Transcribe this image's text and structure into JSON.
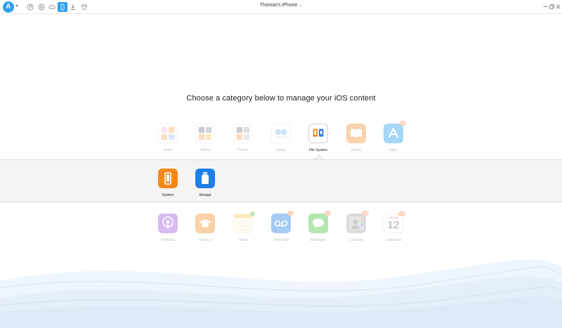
{
  "app": {
    "logo_text": "A",
    "device_title": "Thomas's iPhone"
  },
  "toolbar": {
    "items": [
      {
        "name": "music-icon"
      },
      {
        "name": "restore-icon"
      },
      {
        "name": "cloud-icon"
      },
      {
        "name": "device-icon",
        "active": true
      },
      {
        "name": "download-icon"
      },
      {
        "name": "tshirt-icon"
      }
    ]
  },
  "heading": "Choose a category below to manage your iOS content",
  "categories_top": [
    {
      "label": "Audio",
      "icon": "audio-icon"
    },
    {
      "label": "Videos",
      "icon": "videos-icon"
    },
    {
      "label": "Photos",
      "icon": "photos-icon"
    },
    {
      "label": "Selais",
      "icon": "selais-icon"
    },
    {
      "label": "File System",
      "icon": "file-system-icon",
      "active": true
    },
    {
      "label": "Books",
      "icon": "books-icon"
    },
    {
      "label": "Apps",
      "icon": "apps-icon",
      "badge": "10"
    }
  ],
  "subcategories": [
    {
      "label": "System",
      "icon": "system-icon"
    },
    {
      "label": "Storage",
      "icon": "storage-icon"
    }
  ],
  "categories_bottom": [
    {
      "label": "Podcasts",
      "icon": "podcasts-icon"
    },
    {
      "label": "iTunes U",
      "icon": "itunes-u-icon"
    },
    {
      "label": "Notes",
      "icon": "notes-icon",
      "badge": ""
    },
    {
      "label": "Voice Mail",
      "icon": "voice-mail-icon",
      "badge": "2"
    },
    {
      "label": "Messages",
      "icon": "messages-icon",
      "badge": "28"
    },
    {
      "label": "Contacts",
      "icon": "contacts-icon",
      "badge": "165"
    },
    {
      "label": "Calendars",
      "icon": "calendars-icon",
      "badge": "137",
      "day_name": "Sunday",
      "day_number": "12"
    }
  ],
  "colors": {
    "accent": "#2d9ff0",
    "orange": "#f28a1b",
    "badge": "#f39a6b"
  }
}
